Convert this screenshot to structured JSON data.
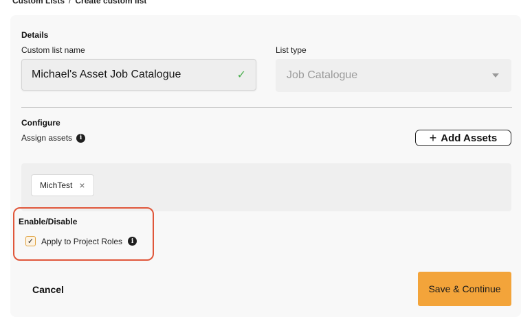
{
  "breadcrumb": {
    "parent": "Custom Lists",
    "separator": "/",
    "current": "Create custom list"
  },
  "details": {
    "section_title": "Details",
    "name_label": "Custom list name",
    "name_value": "Michael's Asset Job Catalogue",
    "name_valid_icon": "check-icon",
    "type_label": "List type",
    "type_value": "Job Catalogue"
  },
  "configure": {
    "section_title": "Configure",
    "assign_label": "Assign assets",
    "info_glyph": "i",
    "add_button_label": "Add Assets",
    "assets": [
      {
        "label": "MichTest",
        "remove_glyph": "×"
      }
    ]
  },
  "enable": {
    "section_title": "Enable/Disable",
    "checkbox_label": "Apply to Project Roles",
    "checked": true,
    "check_glyph": "✓"
  },
  "footer": {
    "cancel_label": "Cancel",
    "save_label": "Save & Continue"
  },
  "colors": {
    "accent": "#f3a43a",
    "highlight_border": "#e0563a",
    "valid": "#4caf50"
  }
}
